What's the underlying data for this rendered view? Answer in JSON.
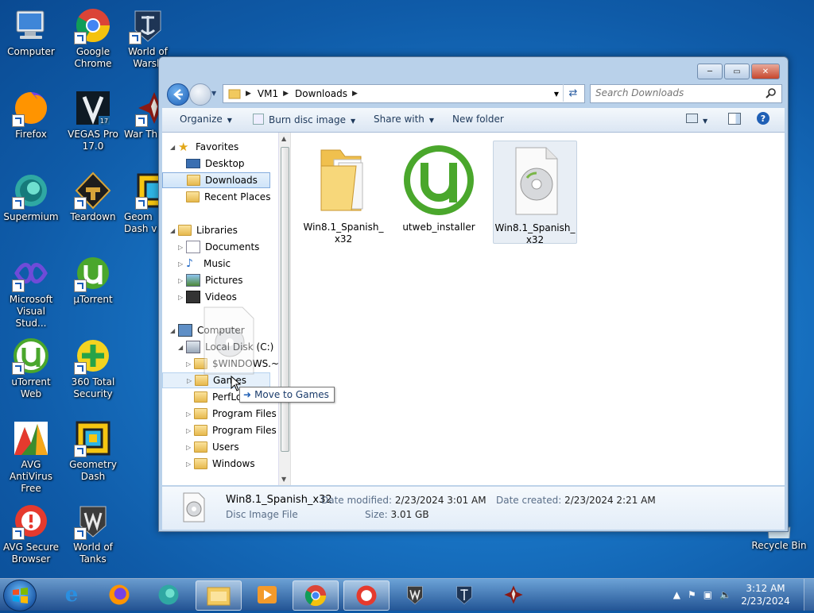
{
  "desktop": {
    "icons": [
      {
        "label": "Computer"
      },
      {
        "label": "Google Chrome"
      },
      {
        "label": "World of Warsh"
      },
      {
        "label": "Firefox"
      },
      {
        "label": "VEGAS Pro 17.0"
      },
      {
        "label": "War Th"
      },
      {
        "label": "Supermium"
      },
      {
        "label": "Teardown"
      },
      {
        "label": "Geom Dash v"
      },
      {
        "label": "Microsoft Visual Stud..."
      },
      {
        "label": "µTorrent"
      },
      {
        "label": "uTorrent Web"
      },
      {
        "label": "360 Total Security"
      },
      {
        "label": "AVG AntiVirus Free"
      },
      {
        "label": "Geometry Dash"
      },
      {
        "label": "AVG Secure Browser"
      },
      {
        "label": "World of Tanks"
      },
      {
        "label": "Recycle Bin"
      }
    ]
  },
  "window": {
    "address": [
      "VM1",
      "Downloads"
    ],
    "search_placeholder": "Search Downloads",
    "toolbar": {
      "organize": "Organize",
      "burn": "Burn disc image",
      "share": "Share with",
      "new_folder": "New folder"
    },
    "nav": {
      "favorites": "Favorites",
      "desktop": "Desktop",
      "downloads": "Downloads",
      "recent": "Recent Places",
      "libraries": "Libraries",
      "documents": "Documents",
      "music": "Music",
      "pictures": "Pictures",
      "videos": "Videos",
      "computer": "Computer",
      "local_disk": "Local Disk (C:)",
      "windows_bt": "$WINDOWS.~BT",
      "games": "Games",
      "perflogs": "PerfLogs",
      "program_files": "Program Files",
      "program_files_x86": "Program Files (",
      "users": "Users",
      "windows": "Windows"
    },
    "files": [
      {
        "name": "Win8.1_Spanish_x32",
        "type": "folder"
      },
      {
        "name": "utweb_installer",
        "type": "utorrent"
      },
      {
        "name": "Win8.1_Spanish_x32",
        "type": "disc-image"
      }
    ],
    "details": {
      "name": "Win8.1_Spanish_x32",
      "type": "Disc Image File",
      "modified_label": "Date modified:",
      "modified": "2/23/2024 3:01 AM",
      "size_label": "Size:",
      "size": "3.01 GB",
      "created_label": "Date created:",
      "created": "2/23/2024 2:21 AM"
    },
    "drag_tooltip": "Move to Games"
  },
  "taskbar": {
    "time": "3:12 AM",
    "date": "2/23/2024"
  },
  "colors": {
    "accent": "#1c5fb6",
    "selection": "#cfe4f9",
    "utorrent_green": "#4aa72c"
  }
}
